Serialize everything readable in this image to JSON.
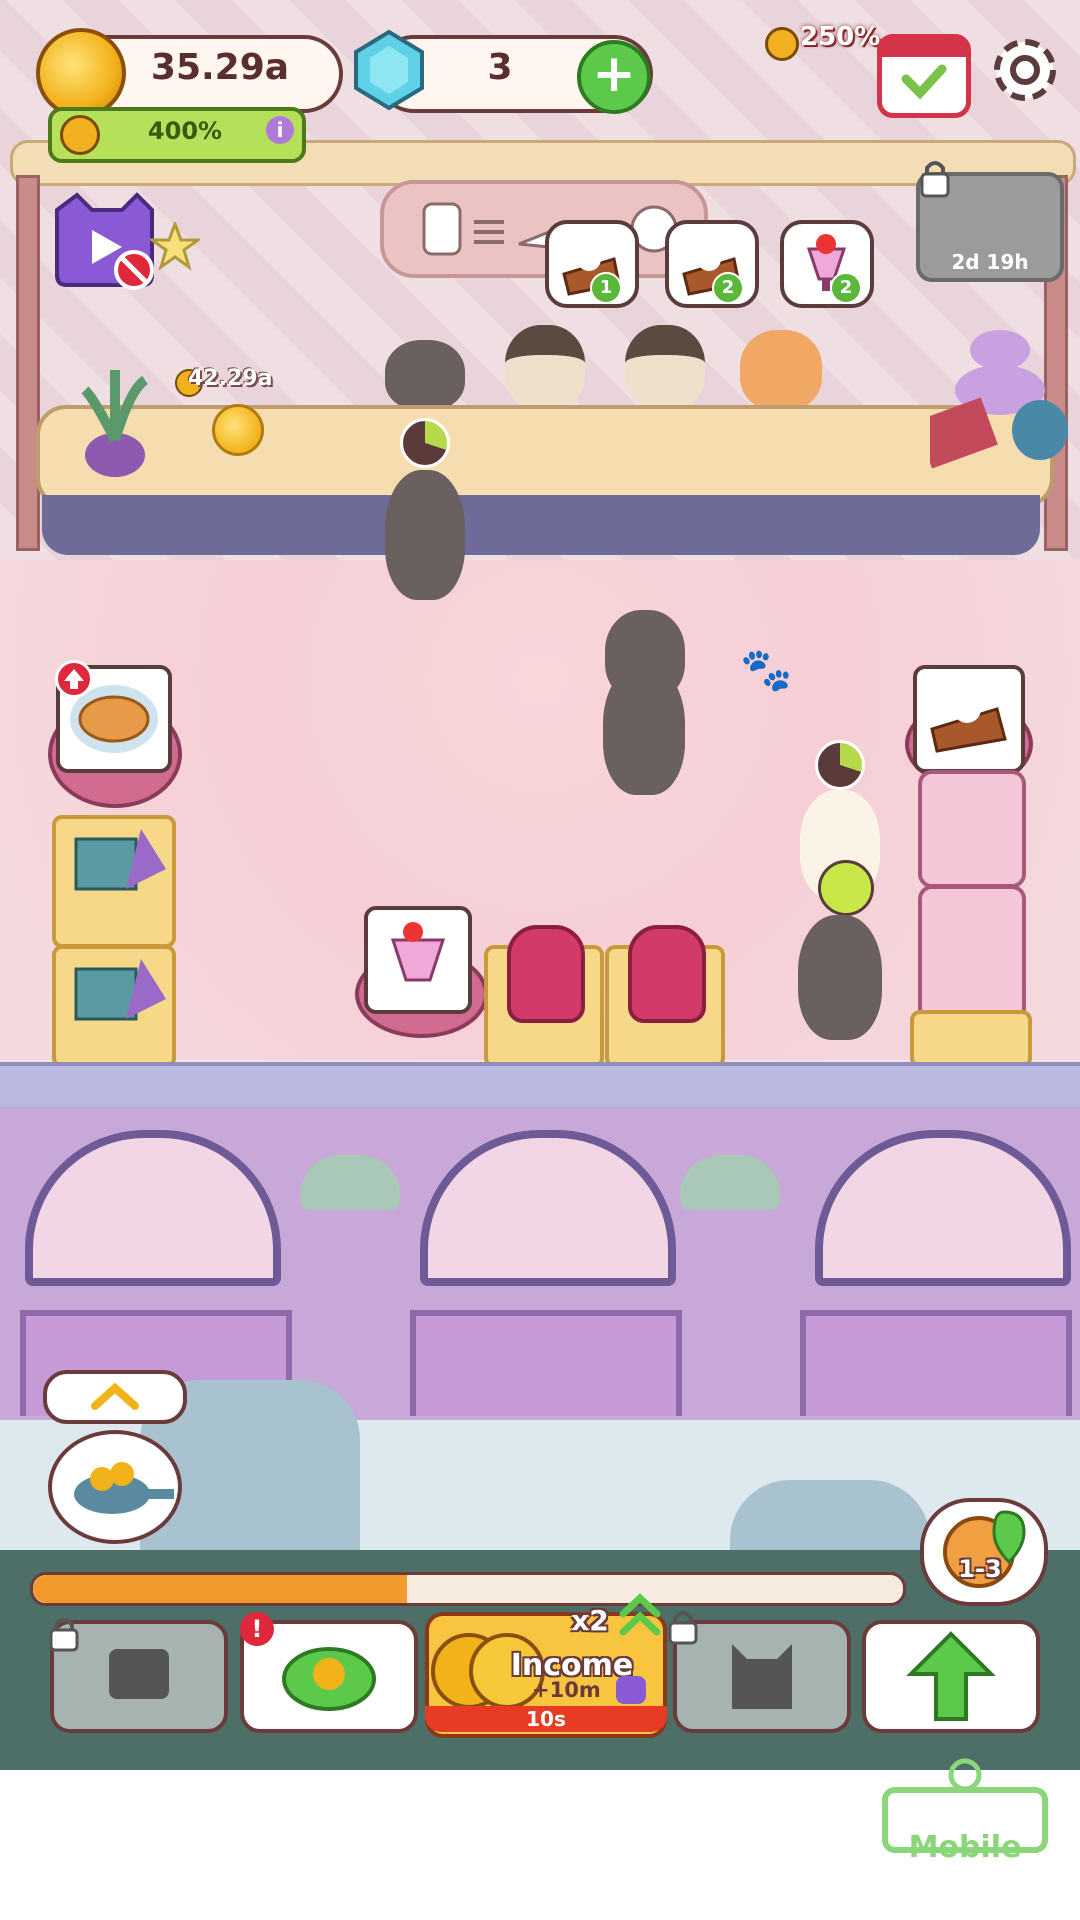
{
  "hud": {
    "coins": "35.29a",
    "coin_boost": "400%",
    "gems": "3",
    "income_boost": "250%"
  },
  "locked_timer": "2d 19h",
  "floating_coin_label": "42.29a",
  "orders": [
    {
      "item": "cake-slice",
      "count": "1"
    },
    {
      "item": "cake-slice",
      "count": "2"
    },
    {
      "item": "parfait",
      "count": "2"
    }
  ],
  "bottom_bar": {
    "progress_fraction": 0.43,
    "income_multiplier": "x2",
    "income_label": "Income",
    "income_bonus": "+10m",
    "income_timer": "10s",
    "level": "1-3"
  },
  "watermark": "Mobile",
  "colors": {
    "progress": "#f29a2c",
    "income_slot": "#f9c540",
    "timer": "#e63c24",
    "boost": "#b6e05a"
  }
}
